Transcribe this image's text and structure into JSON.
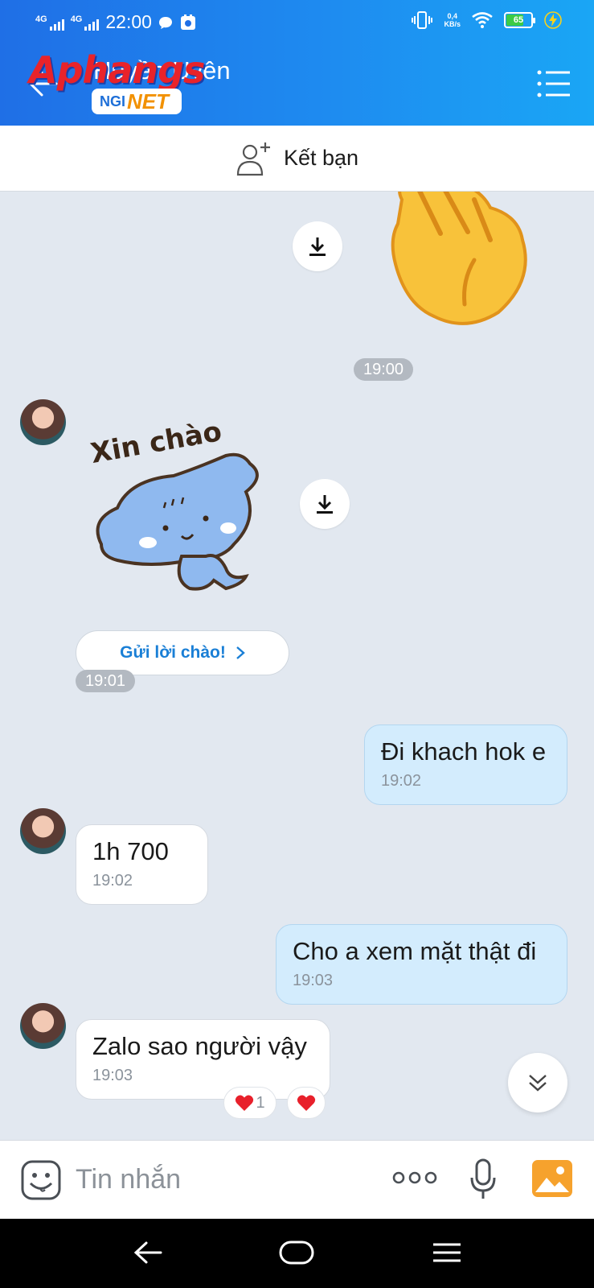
{
  "status_bar": {
    "network1": "4G",
    "network2": "4G",
    "time": "22:00",
    "net_speed_value": "0,4",
    "net_speed_unit": "KB/s",
    "battery": "65"
  },
  "header": {
    "contact_name": "Huyền Uyên",
    "watermark_main": "Aphangs",
    "watermark_sub_a": "NGI",
    "watermark_sub_b": "NET"
  },
  "add_friend": {
    "label": "Kết bạn"
  },
  "chat": {
    "timestamps": [
      "19:00",
      "19:01"
    ],
    "sticker_text": "Xin chào",
    "greet_button": "Gửi lời chào!",
    "messages": [
      {
        "side": "out",
        "text": "Đi khach hok e",
        "time": "19:02"
      },
      {
        "side": "in",
        "text": "1h 700",
        "time": "19:02"
      },
      {
        "side": "out",
        "text": "Cho a xem mặt thật đi",
        "time": "19:03"
      },
      {
        "side": "in",
        "text": "Zalo sao người vậy",
        "time": "19:03"
      }
    ],
    "reaction_count": "1"
  },
  "input_bar": {
    "placeholder": "Tin nhắn"
  },
  "colors": {
    "header_gradient_start": "#1f6fe6",
    "header_gradient_end": "#1aa6f5",
    "chat_background": "#e2e8f0",
    "outgoing_bubble": "#d3ecfd",
    "incoming_bubble": "#ffffff",
    "accent_blue": "#1a7fd6"
  }
}
